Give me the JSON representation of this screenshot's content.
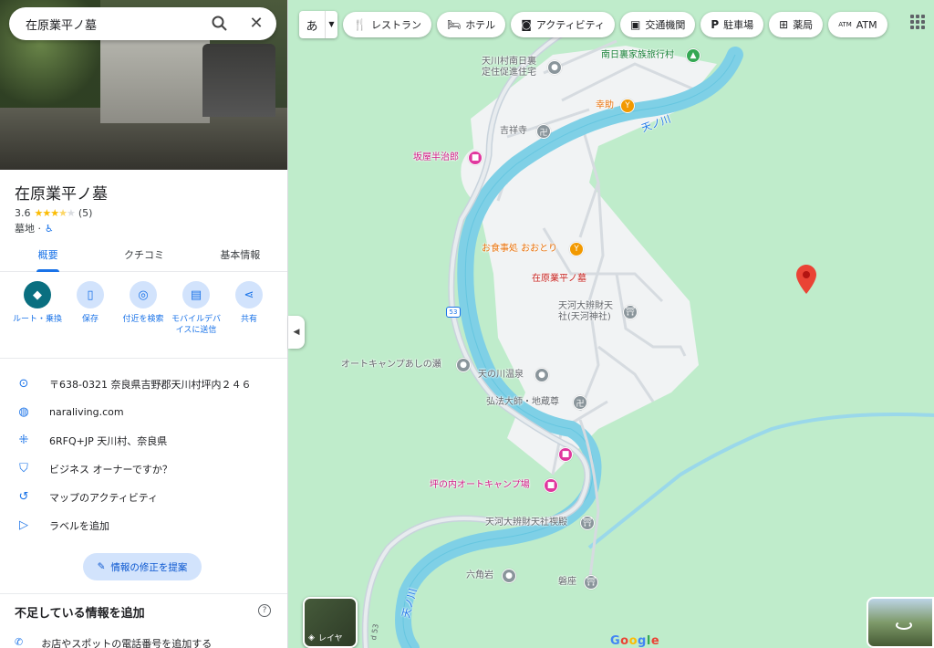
{
  "search": {
    "value": "在原業平ノ墓"
  },
  "place": {
    "title": "在原業平ノ墓",
    "rating": "3.6",
    "review_count": "(5)",
    "category": "墓地 ·",
    "stars_filled": 3.5
  },
  "tabs": [
    {
      "label": "概要",
      "active": true
    },
    {
      "label": "クチコミ",
      "active": false
    },
    {
      "label": "基本情報",
      "active": false
    }
  ],
  "actions": [
    {
      "label": "ルート・乗換",
      "icon": "directions-icon"
    },
    {
      "label": "保存",
      "icon": "bookmark-icon"
    },
    {
      "label": "付近を検索",
      "icon": "nearby-icon"
    },
    {
      "label": "モバイルデバイスに送信",
      "icon": "phone-send-icon"
    },
    {
      "label": "共有",
      "icon": "share-icon"
    }
  ],
  "info": [
    {
      "text": "〒638-0321 奈良県吉野郡天川村坪内２４６",
      "icon": "location-pin-icon"
    },
    {
      "text": "naraliving.com",
      "icon": "globe-icon"
    },
    {
      "text": "6RFQ+JP 天川村、奈良県",
      "icon": "plus-code-icon"
    },
    {
      "text": "ビジネス オーナーですか？",
      "icon": "verified-shield-icon"
    },
    {
      "text": "マップのアクティビティ",
      "icon": "history-icon"
    },
    {
      "text": "ラベルを追加",
      "icon": "label-icon"
    }
  ],
  "suggest_edit": "情報の修正を提案",
  "missing": {
    "title": "不足している情報を追加",
    "phone": "お店やスポットの電話番号を追加する"
  },
  "map": {
    "lang_label": "あ",
    "chips": [
      {
        "label": "レストラン",
        "icon": "restaurant-icon"
      },
      {
        "label": "ホテル",
        "icon": "hotel-icon"
      },
      {
        "label": "アクティビティ",
        "icon": "camera-icon"
      },
      {
        "label": "交通機関",
        "icon": "transit-icon"
      },
      {
        "label": "駐車場",
        "icon": "parking-icon"
      },
      {
        "label": "薬局",
        "icon": "pharmacy-icon"
      },
      {
        "label": "ATM",
        "icon": "atm-icon"
      }
    ],
    "labels": {
      "housing": "天川村南日裏\n定住促進住宅",
      "travel": "南日裏家族旅行村",
      "kosuke": "幸助",
      "river1": "天ノ川",
      "kissho": "吉祥寺",
      "sakaya": "坂屋半治郎",
      "oshokuji": "お食事処 おおとり",
      "main": "在原業平ノ墓",
      "benzaiten": "天河大辨財天\n社(天河神社)",
      "autocamp": "オートキャンプあしの瀬",
      "onsen": "天の川温泉",
      "kobo": "弘法大師・地蔵尊",
      "tsubo": "坪の内オートキャンプ場",
      "haiden": "天河大辨財天社禊殿",
      "rokkaku": "六角岩",
      "iwakura": "磐座",
      "river2": "天ノ川",
      "route": "53",
      "road": "d 53"
    },
    "layers_label": "レイヤ",
    "logo": "Google"
  },
  "colors": {
    "accent": "#1a73e8",
    "map_land": "#bfeccb",
    "river": "#7fd0e6",
    "star": "#fbbc04"
  }
}
